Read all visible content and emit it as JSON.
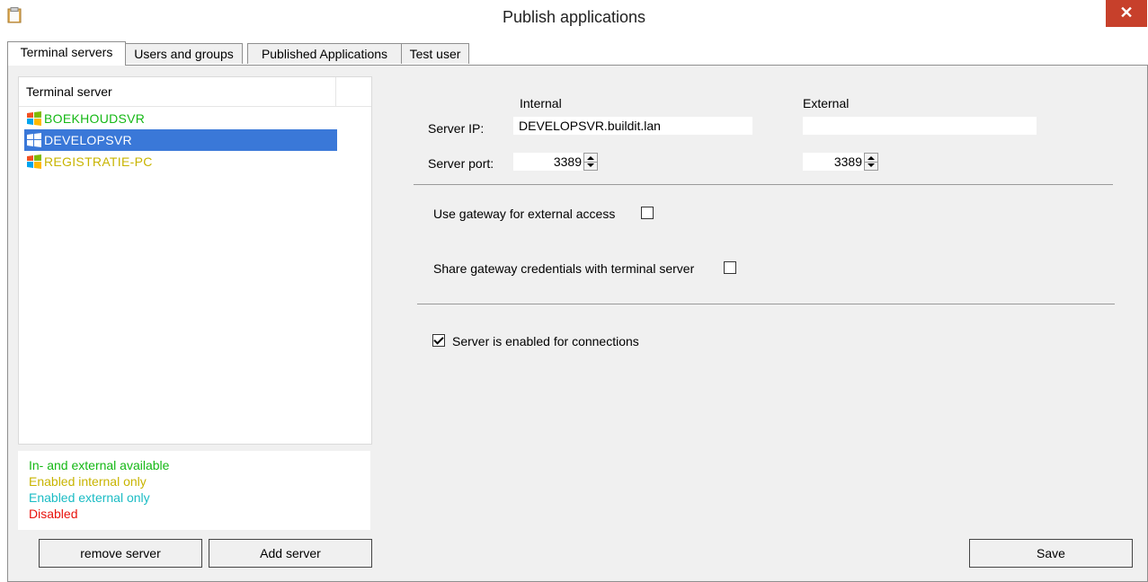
{
  "window": {
    "title": "Publish applications",
    "close_glyph": "✕"
  },
  "tabs": [
    {
      "label": "Terminal servers"
    },
    {
      "label": "Users and groups"
    },
    {
      "label": "Published Applications"
    },
    {
      "label": "Test user"
    }
  ],
  "server_list": {
    "header": "Terminal server",
    "items": [
      {
        "name": "BOEKHOUDSVR",
        "color": "#15b815",
        "icon": "windows-7-icon"
      },
      {
        "name": "DEVELOPSVR",
        "color": "#ffffff",
        "icon": "windows-8-icon"
      },
      {
        "name": "REGISTRATIE-PC",
        "color": "#c8b400",
        "icon": "windows-7-icon"
      }
    ]
  },
  "legend": [
    {
      "text": "In- and external available",
      "color": "#15b815"
    },
    {
      "text": "Enabled internal only",
      "color": "#c8b400"
    },
    {
      "text": "Enabled external only",
      "color": "#1bbcc4"
    },
    {
      "text": "Disabled",
      "color": "#e8120c"
    }
  ],
  "buttons": {
    "remove": "remove server",
    "add": "Add server",
    "save": "Save"
  },
  "settings": {
    "internal_header": "Internal",
    "external_header": "External",
    "server_ip_label": "Server IP:",
    "server_port_label": "Server port:",
    "internal_ip": "DEVELOPSVR.buildit.lan",
    "external_ip": "",
    "internal_port": "3389",
    "external_port": "3389",
    "use_gateway_label": "Use gateway for external access",
    "use_gateway_checked": false,
    "share_credentials_label": "Share gateway credentials with terminal server",
    "share_credentials_checked": false,
    "enabled_label": "Server is enabled for connections",
    "enabled_checked": true
  }
}
